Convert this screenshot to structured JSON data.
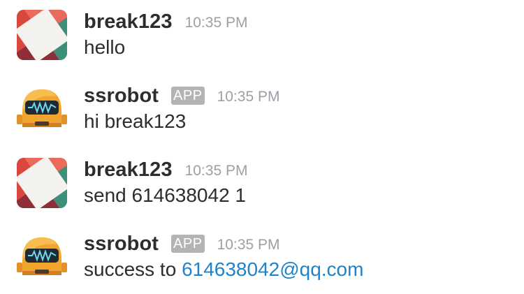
{
  "messages": [
    {
      "user": "break123",
      "time": "10:35 PM",
      "text": "hello",
      "avatar_icon": "checkered-avatar-icon"
    },
    {
      "user": "ssrobot",
      "badge": "APP",
      "time": "10:35 PM",
      "text": "hi break123",
      "avatar_icon": "robot-avatar-icon"
    },
    {
      "user": "break123",
      "time": "10:35 PM",
      "text": "send 614638042 1",
      "avatar_icon": "checkered-avatar-icon"
    },
    {
      "user": "ssrobot",
      "badge": "APP",
      "time": "10:35 PM",
      "text_prefix": "success to ",
      "link_text": "614638042@qq.com",
      "avatar_icon": "robot-avatar-icon"
    }
  ],
  "colors": {
    "username": "#2c2d30",
    "timestamp": "#9e9ea6",
    "badge_bg": "#b4b4b4",
    "link": "#1f83c9"
  }
}
